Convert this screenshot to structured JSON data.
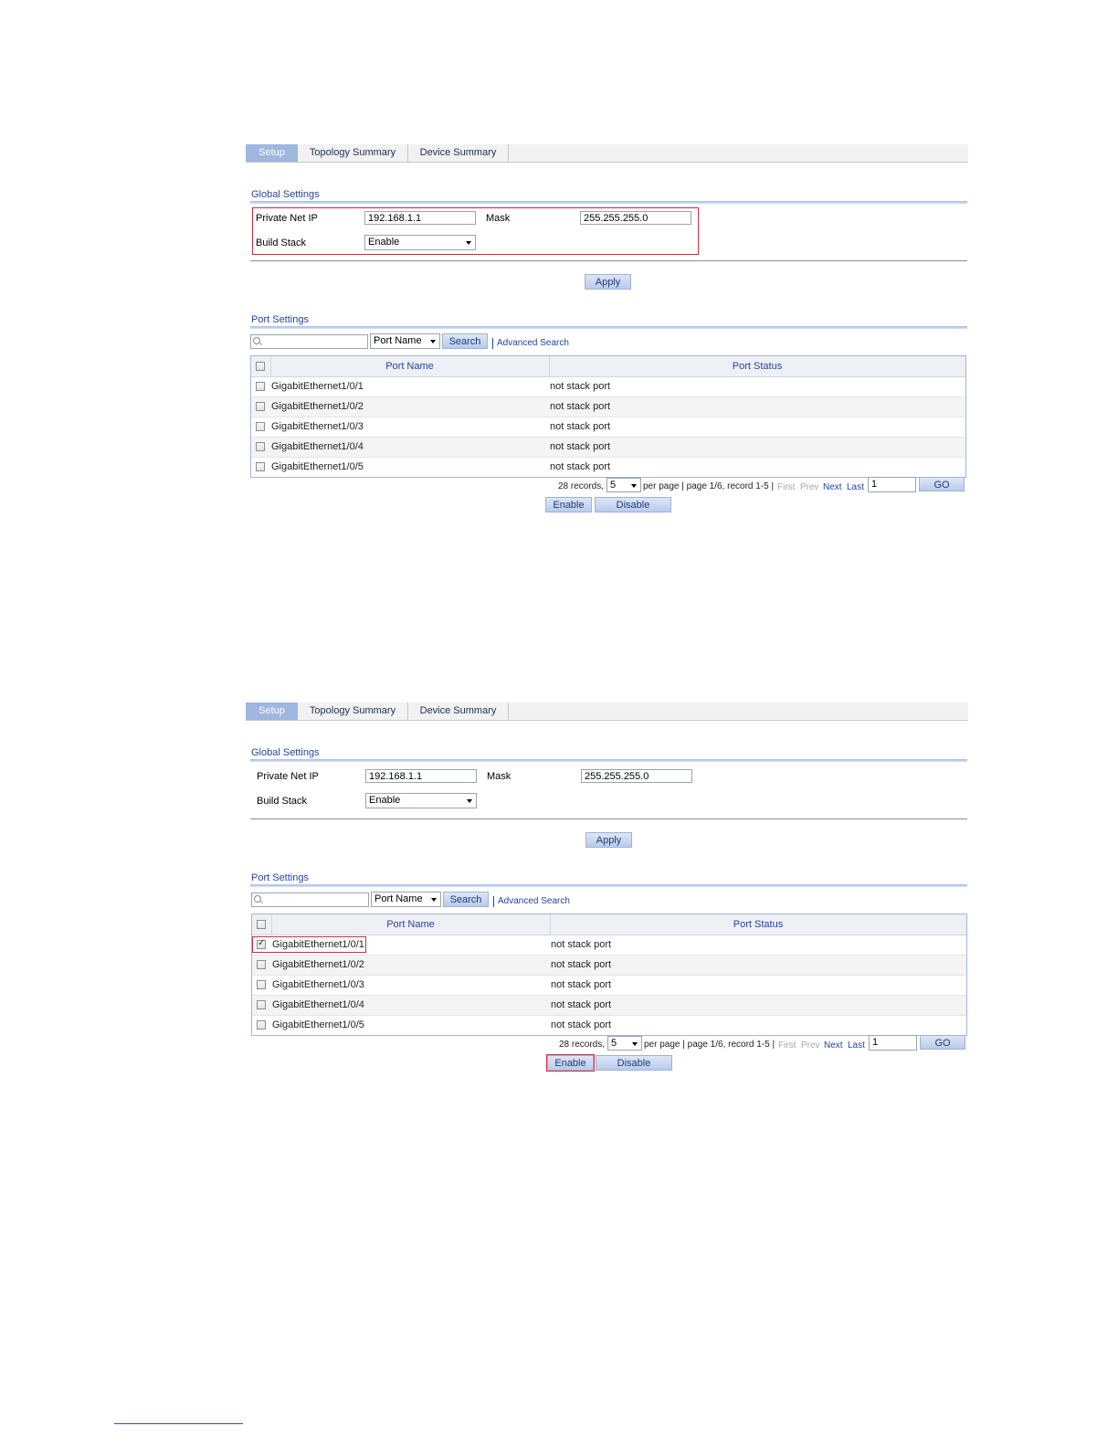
{
  "screens": [
    {
      "tabs": [
        "Setup",
        "Topology Summary",
        "Device Summary"
      ],
      "global_settings": {
        "title": "Global Settings",
        "private_net_ip_label": "Private Net IP",
        "private_net_ip_value": "192.168.1.1",
        "mask_label": "Mask",
        "mask_value": "255.255.255.0",
        "build_stack_label": "Build Stack",
        "build_stack_value": "Enable"
      },
      "apply_label": "Apply",
      "port_settings": {
        "title": "Port Settings",
        "search_field": "Port Name",
        "search_button": "Search",
        "advanced_search": "Advanced Search",
        "columns": [
          "Port Name",
          "Port Status"
        ],
        "rows": [
          {
            "name": "GigabitEthernet1/0/1",
            "status": "not stack port",
            "checked": false
          },
          {
            "name": "GigabitEthernet1/0/2",
            "status": "not stack port",
            "checked": false
          },
          {
            "name": "GigabitEthernet1/0/3",
            "status": "not stack port",
            "checked": false
          },
          {
            "name": "GigabitEthernet1/0/4",
            "status": "not stack port",
            "checked": false
          },
          {
            "name": "GigabitEthernet1/0/5",
            "status": "not stack port",
            "checked": false
          }
        ]
      },
      "pager": {
        "records": "28 records,",
        "per_page_value": "5",
        "per_page_text": "per page | page 1/6, record 1-5 |",
        "first": "First",
        "prev": "Prev",
        "next": "Next",
        "last": "Last",
        "page_input": "1",
        "go": "GO"
      },
      "enable_label": "Enable",
      "disable_label": "Disable"
    },
    {
      "tabs": [
        "Setup",
        "Topology Summary",
        "Device Summary"
      ],
      "global_settings": {
        "title": "Global Settings",
        "private_net_ip_label": "Private Net IP",
        "private_net_ip_value": "192.168.1.1",
        "mask_label": "Mask",
        "mask_value": "255.255.255.0",
        "build_stack_label": "Build Stack",
        "build_stack_value": "Enable"
      },
      "apply_label": "Apply",
      "port_settings": {
        "title": "Port Settings",
        "search_field": "Port Name",
        "search_button": "Search",
        "advanced_search": "Advanced Search",
        "columns": [
          "Port Name",
          "Port Status"
        ],
        "rows": [
          {
            "name": "GigabitEthernet1/0/1",
            "status": "not stack port",
            "checked": true
          },
          {
            "name": "GigabitEthernet1/0/2",
            "status": "not stack port",
            "checked": false
          },
          {
            "name": "GigabitEthernet1/0/3",
            "status": "not stack port",
            "checked": false
          },
          {
            "name": "GigabitEthernet1/0/4",
            "status": "not stack port",
            "checked": false
          },
          {
            "name": "GigabitEthernet1/0/5",
            "status": "not stack port",
            "checked": false
          }
        ]
      },
      "pager": {
        "records": "28 records,",
        "per_page_value": "5",
        "per_page_text": "per page | page 1/6, record 1-5 |",
        "first": "First",
        "prev": "Prev",
        "next": "Next",
        "last": "Last",
        "page_input": "1",
        "go": "GO"
      },
      "enable_label": "Enable",
      "disable_label": "Disable"
    }
  ],
  "colors": {
    "accent": "#9fb6de",
    "link": "#2444a4",
    "highlight": "#d52b3a"
  }
}
